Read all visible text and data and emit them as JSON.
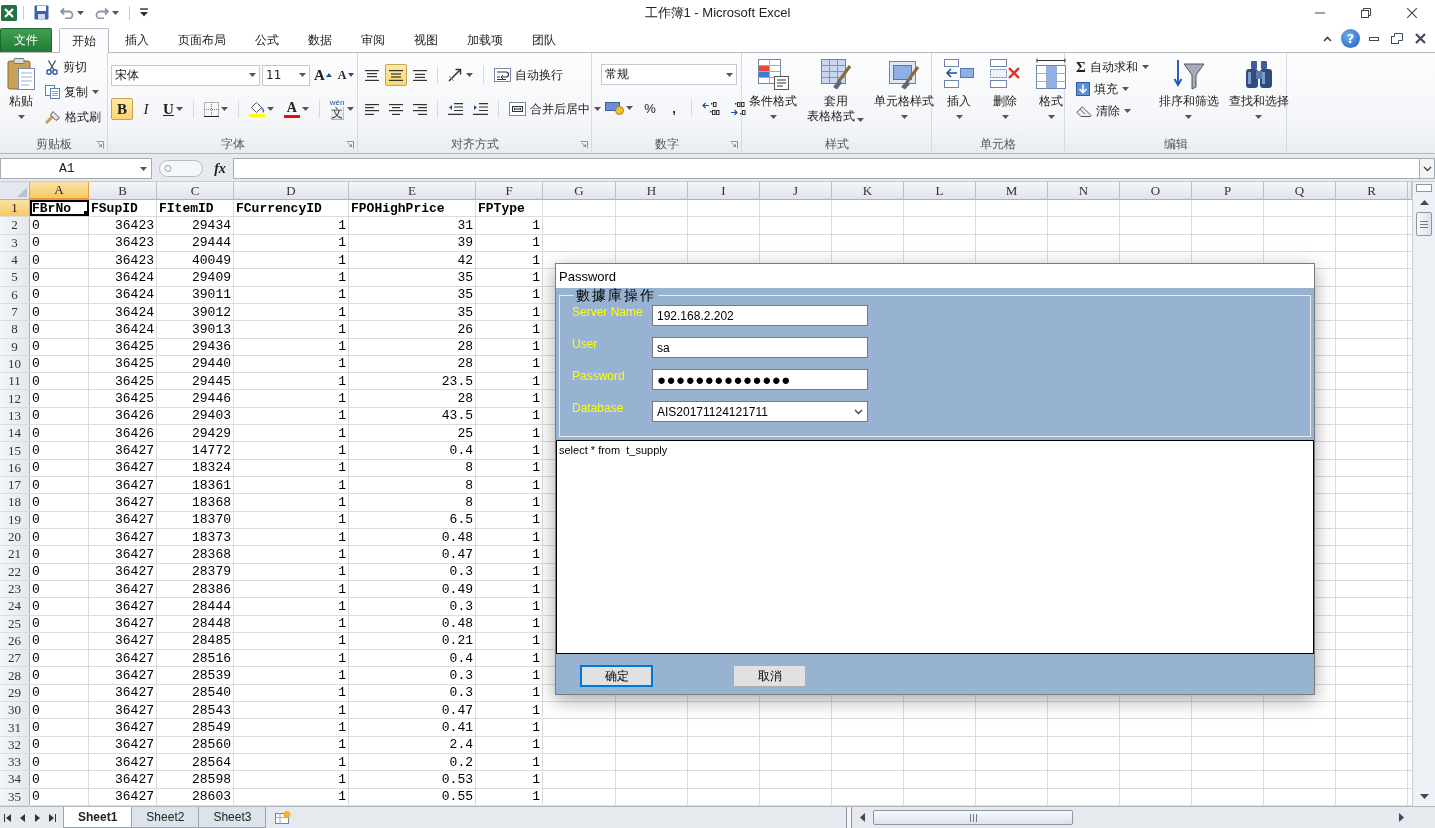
{
  "window": {
    "title": "工作簿1 - Microsoft Excel"
  },
  "ribbon_tabs": [
    {
      "label": "文件",
      "kind": "file",
      "selected": false
    },
    {
      "label": "开始",
      "kind": "tab",
      "selected": true
    },
    {
      "label": "插入",
      "kind": "tab",
      "selected": false
    },
    {
      "label": "页面布局",
      "kind": "tab",
      "selected": false
    },
    {
      "label": "公式",
      "kind": "tab",
      "selected": false
    },
    {
      "label": "数据",
      "kind": "tab",
      "selected": false
    },
    {
      "label": "审阅",
      "kind": "tab",
      "selected": false
    },
    {
      "label": "视图",
      "kind": "tab",
      "selected": false
    },
    {
      "label": "加载项",
      "kind": "tab",
      "selected": false
    },
    {
      "label": "团队",
      "kind": "tab",
      "selected": false
    }
  ],
  "help": "?",
  "ribbon": {
    "clipboard": {
      "label": "剪贴板",
      "paste": "粘贴",
      "cut": "剪切",
      "copy": "复制",
      "format_painter": "格式刷"
    },
    "font": {
      "label": "字体",
      "font_name": "宋体",
      "font_size": "11",
      "grow_font": "A",
      "shrink_font": "A",
      "bold": {
        "label": "B",
        "pressed": true
      },
      "italic": {
        "label": "I",
        "pressed": false
      },
      "underline": {
        "label": "U",
        "pressed": false
      },
      "font_color": "A",
      "phonetic": {
        "pinyin": "wén",
        "char": "文"
      }
    },
    "alignment": {
      "label": "对齐方式",
      "vertical": [
        {
          "selected": false
        },
        {
          "selected": true
        },
        {
          "selected": false
        }
      ],
      "horizontal": [
        {
          "selected": false
        },
        {
          "selected": false
        },
        {
          "selected": false
        }
      ],
      "wrap_text": "自动换行",
      "merge_center": "合并后居中"
    },
    "number": {
      "label": "数字",
      "format": "常规",
      "percent": "%",
      "comma": ","
    },
    "styles": {
      "label": "样式",
      "conditional": "条件格式",
      "table": [
        "套用",
        "表格格式"
      ],
      "cell_styles": "单元格样式"
    },
    "cells": {
      "label": "单元格",
      "insert": "插入",
      "delete": "删除",
      "format": "格式"
    },
    "editing": {
      "label": "编辑",
      "sigma": "Σ",
      "autosum": "自动求和",
      "fill": "填充",
      "clear": "清除",
      "sort": "排序和筛选",
      "find": "查找和选择"
    }
  },
  "formula_bar": {
    "name_box": "A1",
    "fx": "fx"
  },
  "sheet": {
    "columns": [
      {
        "label": "A",
        "selected": true
      },
      {
        "label": "B",
        "selected": false
      },
      {
        "label": "C",
        "selected": false
      },
      {
        "label": "D",
        "selected": false
      },
      {
        "label": "E",
        "selected": false
      },
      {
        "label": "F",
        "selected": false
      },
      {
        "label": "G",
        "selected": false
      },
      {
        "label": "H",
        "selected": false
      },
      {
        "label": "I",
        "selected": false
      },
      {
        "label": "J",
        "selected": false
      },
      {
        "label": "K",
        "selected": false
      },
      {
        "label": "L",
        "selected": false
      },
      {
        "label": "M",
        "selected": false
      },
      {
        "label": "N",
        "selected": false
      },
      {
        "label": "O",
        "selected": false
      },
      {
        "label": "P",
        "selected": false
      },
      {
        "label": "Q",
        "selected": false
      },
      {
        "label": "R",
        "selected": false
      }
    ],
    "rows": [
      {
        "number": "1",
        "kind": "header",
        "selected": true,
        "cells": [
          "FBrNo",
          "FSupID",
          "FItemID",
          "FCurrencyID",
          "FPOHighPrice",
          "FPType"
        ]
      },
      {
        "number": "2",
        "kind": "data",
        "selected": false,
        "cells": [
          "0",
          "36423",
          "29434",
          "1",
          "31",
          "1"
        ]
      },
      {
        "number": "3",
        "kind": "data",
        "selected": false,
        "cells": [
          "0",
          "36423",
          "29444",
          "1",
          "39",
          "1"
        ]
      },
      {
        "number": "4",
        "kind": "data",
        "selected": false,
        "cells": [
          "0",
          "36423",
          "40049",
          "1",
          "42",
          "1"
        ]
      },
      {
        "number": "5",
        "kind": "data",
        "selected": false,
        "cells": [
          "0",
          "36424",
          "29409",
          "1",
          "35",
          "1"
        ]
      },
      {
        "number": "6",
        "kind": "data",
        "selected": false,
        "cells": [
          "0",
          "36424",
          "39011",
          "1",
          "35",
          "1"
        ]
      },
      {
        "number": "7",
        "kind": "data",
        "selected": false,
        "cells": [
          "0",
          "36424",
          "39012",
          "1",
          "35",
          "1"
        ]
      },
      {
        "number": "8",
        "kind": "data",
        "selected": false,
        "cells": [
          "0",
          "36424",
          "39013",
          "1",
          "26",
          "1"
        ]
      },
      {
        "number": "9",
        "kind": "data",
        "selected": false,
        "cells": [
          "0",
          "36425",
          "29436",
          "1",
          "28",
          "1"
        ]
      },
      {
        "number": "10",
        "kind": "data",
        "selected": false,
        "cells": [
          "0",
          "36425",
          "29440",
          "1",
          "28",
          "1"
        ]
      },
      {
        "number": "11",
        "kind": "data",
        "selected": false,
        "cells": [
          "0",
          "36425",
          "29445",
          "1",
          "23.5",
          "1"
        ]
      },
      {
        "number": "12",
        "kind": "data",
        "selected": false,
        "cells": [
          "0",
          "36425",
          "29446",
          "1",
          "28",
          "1"
        ]
      },
      {
        "number": "13",
        "kind": "data",
        "selected": false,
        "cells": [
          "0",
          "36426",
          "29403",
          "1",
          "43.5",
          "1"
        ]
      },
      {
        "number": "14",
        "kind": "data",
        "selected": false,
        "cells": [
          "0",
          "36426",
          "29429",
          "1",
          "25",
          "1"
        ]
      },
      {
        "number": "15",
        "kind": "data",
        "selected": false,
        "cells": [
          "0",
          "36427",
          "14772",
          "1",
          "0.4",
          "1"
        ]
      },
      {
        "number": "16",
        "kind": "data",
        "selected": false,
        "cells": [
          "0",
          "36427",
          "18324",
          "1",
          "8",
          "1"
        ]
      },
      {
        "number": "17",
        "kind": "data",
        "selected": false,
        "cells": [
          "0",
          "36427",
          "18361",
          "1",
          "8",
          "1"
        ]
      },
      {
        "number": "18",
        "kind": "data",
        "selected": false,
        "cells": [
          "0",
          "36427",
          "18368",
          "1",
          "8",
          "1"
        ]
      },
      {
        "number": "19",
        "kind": "data",
        "selected": false,
        "cells": [
          "0",
          "36427",
          "18370",
          "1",
          "6.5",
          "1"
        ]
      },
      {
        "number": "20",
        "kind": "data",
        "selected": false,
        "cells": [
          "0",
          "36427",
          "18373",
          "1",
          "0.48",
          "1"
        ]
      },
      {
        "number": "21",
        "kind": "data",
        "selected": false,
        "cells": [
          "0",
          "36427",
          "28368",
          "1",
          "0.47",
          "1"
        ]
      },
      {
        "number": "22",
        "kind": "data",
        "selected": false,
        "cells": [
          "0",
          "36427",
          "28379",
          "1",
          "0.3",
          "1"
        ]
      },
      {
        "number": "23",
        "kind": "data",
        "selected": false,
        "cells": [
          "0",
          "36427",
          "28386",
          "1",
          "0.49",
          "1"
        ]
      },
      {
        "number": "24",
        "kind": "data",
        "selected": false,
        "cells": [
          "0",
          "36427",
          "28444",
          "1",
          "0.3",
          "1"
        ]
      },
      {
        "number": "25",
        "kind": "data",
        "selected": false,
        "cells": [
          "0",
          "36427",
          "28448",
          "1",
          "0.48",
          "1"
        ]
      },
      {
        "number": "26",
        "kind": "data",
        "selected": false,
        "cells": [
          "0",
          "36427",
          "28485",
          "1",
          "0.21",
          "1"
        ]
      },
      {
        "number": "27",
        "kind": "data",
        "selected": false,
        "cells": [
          "0",
          "36427",
          "28516",
          "1",
          "0.4",
          "1"
        ]
      },
      {
        "number": "28",
        "kind": "data",
        "selected": false,
        "cells": [
          "0",
          "36427",
          "28539",
          "1",
          "0.3",
          "1"
        ]
      },
      {
        "number": "29",
        "kind": "data",
        "selected": false,
        "cells": [
          "0",
          "36427",
          "28540",
          "1",
          "0.3",
          "1"
        ]
      },
      {
        "number": "30",
        "kind": "data",
        "selected": false,
        "cells": [
          "0",
          "36427",
          "28543",
          "1",
          "0.47",
          "1"
        ]
      },
      {
        "number": "31",
        "kind": "data",
        "selected": false,
        "cells": [
          "0",
          "36427",
          "28549",
          "1",
          "0.41",
          "1"
        ]
      },
      {
        "number": "32",
        "kind": "data",
        "selected": false,
        "cells": [
          "0",
          "36427",
          "28560",
          "1",
          "2.4",
          "1"
        ]
      },
      {
        "number": "33",
        "kind": "data",
        "selected": false,
        "cells": [
          "0",
          "36427",
          "28564",
          "1",
          "0.2",
          "1"
        ]
      },
      {
        "number": "34",
        "kind": "data",
        "selected": false,
        "cells": [
          "0",
          "36427",
          "28598",
          "1",
          "0.53",
          "1"
        ]
      },
      {
        "number": "35",
        "kind": "data",
        "selected": false,
        "cells": [
          "0",
          "36427",
          "28603",
          "1",
          "0.55",
          "1"
        ]
      }
    ]
  },
  "sheet_tabs": [
    {
      "label": "Sheet1",
      "selected": true
    },
    {
      "label": "Sheet2",
      "selected": false
    },
    {
      "label": "Sheet3",
      "selected": false
    }
  ],
  "dialog": {
    "title": "Password",
    "group_label": "數據庫操作",
    "fields": [
      {
        "label": "Server Name",
        "kind": "text",
        "value": "192.168.2.202"
      },
      {
        "label": "User",
        "kind": "text",
        "value": "sa"
      },
      {
        "label": "Password",
        "kind": "password",
        "value": "●●●●●●●●●●●●●●"
      },
      {
        "label": "Database",
        "kind": "select",
        "value": "AIS20171124121711"
      }
    ],
    "query": "select * from  t_supply",
    "buttons": [
      {
        "label": "确定",
        "focused": true
      },
      {
        "label": "取消",
        "focused": false
      }
    ]
  }
}
